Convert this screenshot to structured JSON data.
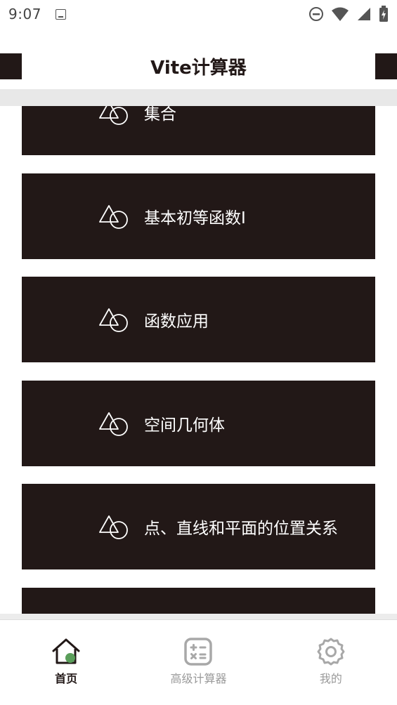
{
  "status_bar": {
    "time": "9:07"
  },
  "header": {
    "title": "Vite计算器"
  },
  "list": {
    "items": [
      {
        "label": "集合",
        "icon": "triangle-circle-icon"
      },
      {
        "label": "基本初等函数Ⅰ",
        "icon": "triangle-circle-icon"
      },
      {
        "label": "函数应用",
        "icon": "triangle-circle-icon"
      },
      {
        "label": "空间几何体",
        "icon": "triangle-circle-icon"
      },
      {
        "label": "点、直线和平面的位置关系",
        "icon": "triangle-circle-icon"
      },
      {
        "label": "",
        "icon": ""
      }
    ]
  },
  "bottom_nav": {
    "items": [
      {
        "label": "首页",
        "icon": "home-icon",
        "active": true
      },
      {
        "label": "高级计算器",
        "icon": "calculator-icon",
        "active": false
      },
      {
        "label": "我的",
        "icon": "gear-icon",
        "active": false
      }
    ]
  },
  "colors": {
    "card_bg": "#221817",
    "accent_green": "#5a9e5a",
    "inactive": "#9a9a9a"
  }
}
